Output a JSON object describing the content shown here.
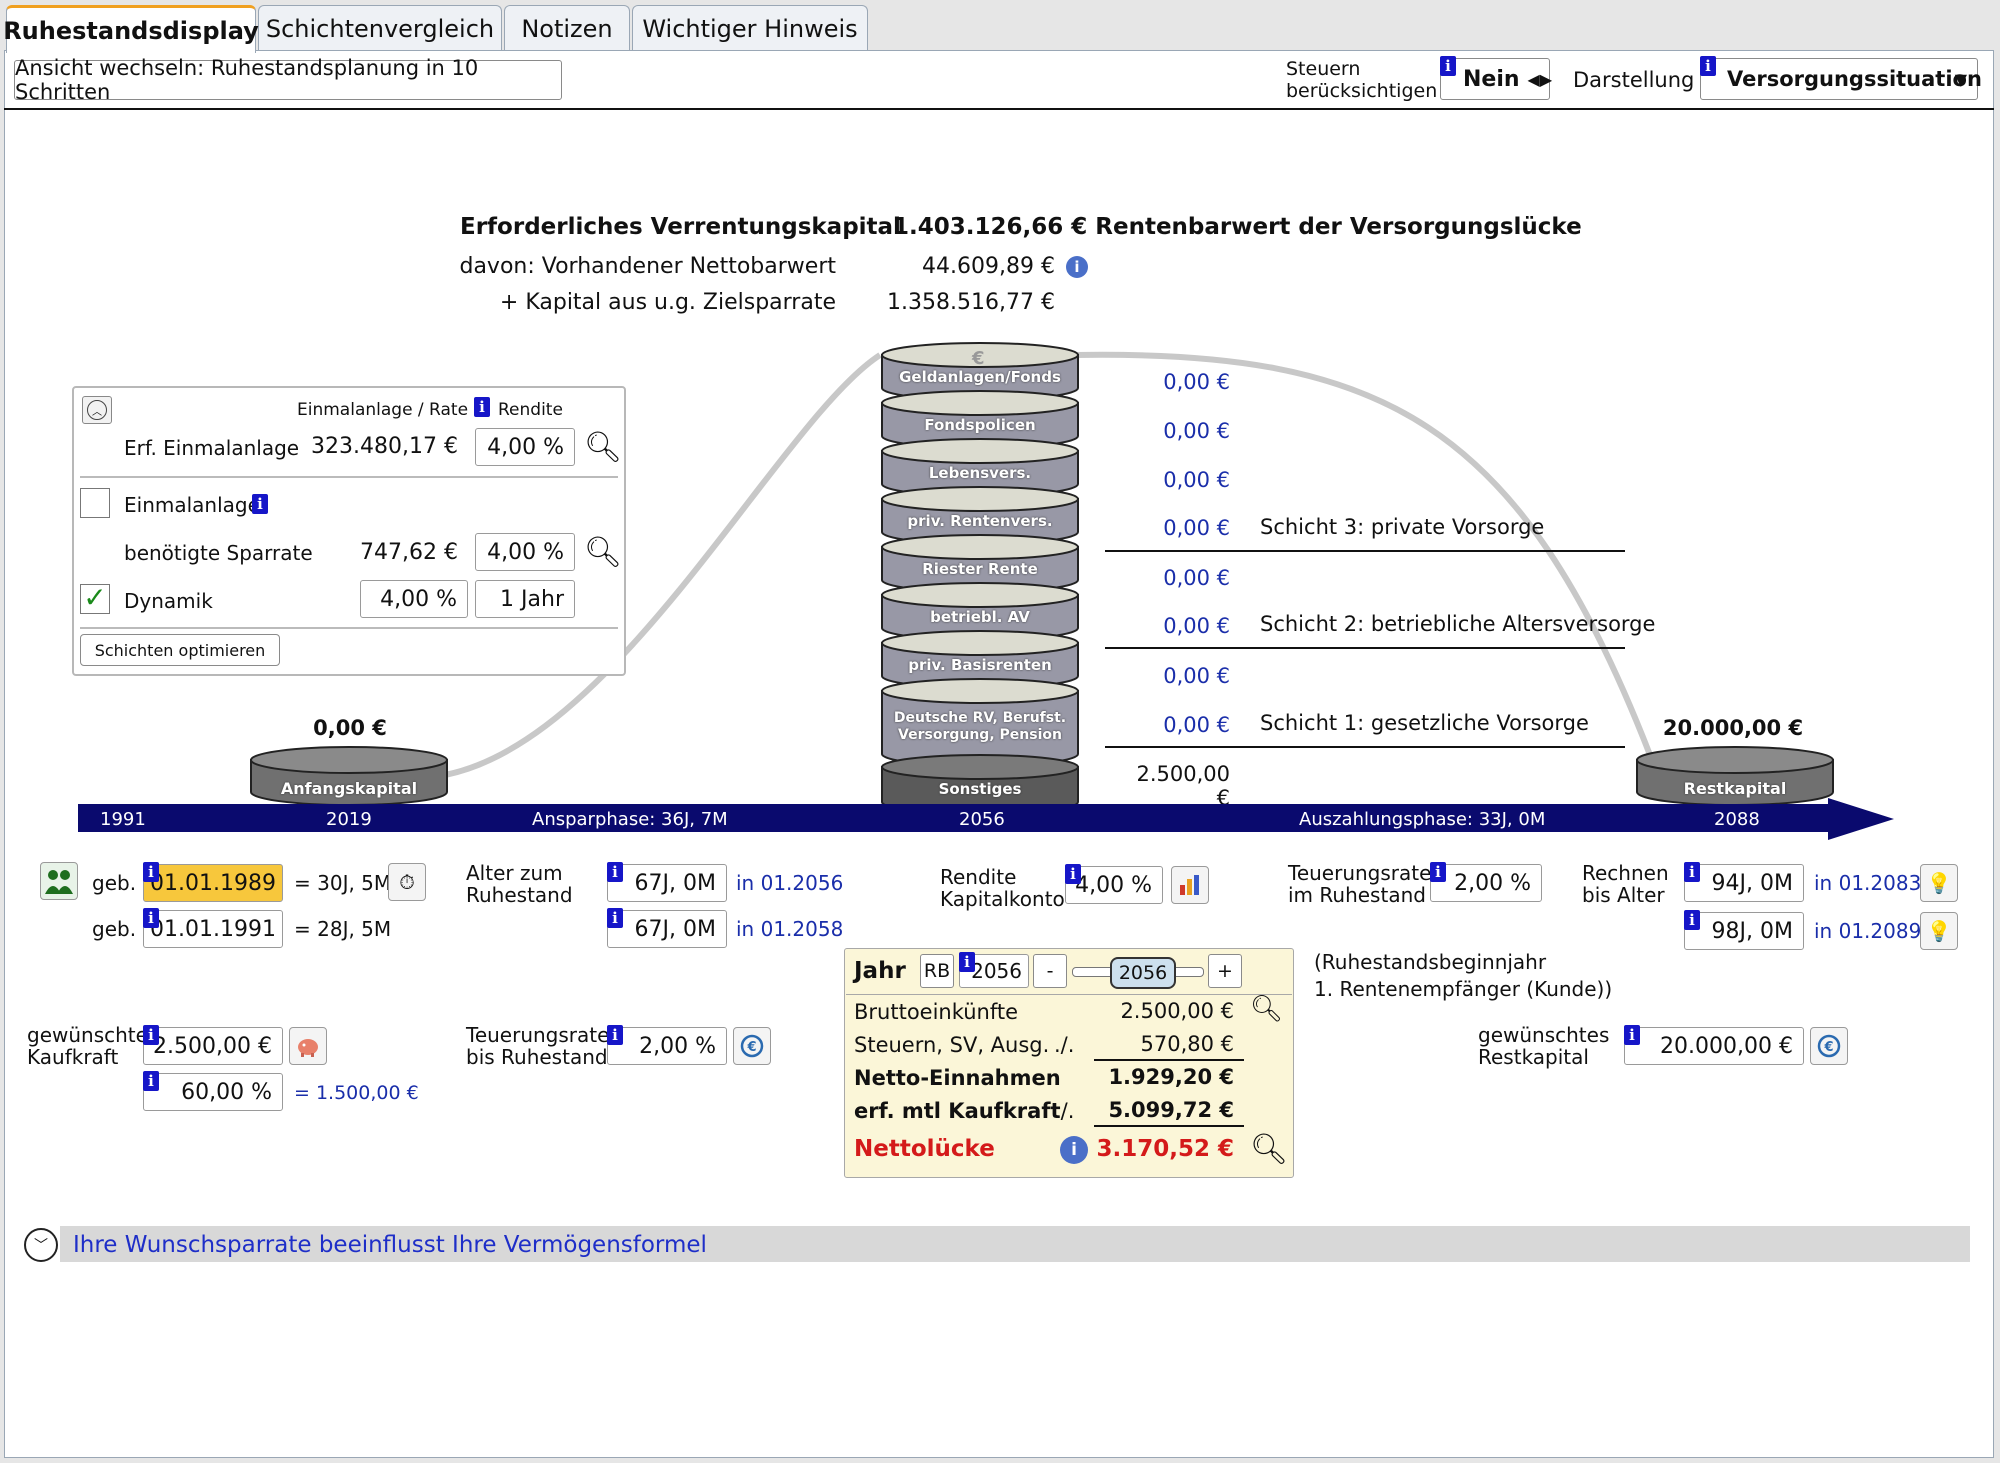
{
  "tabs": [
    {
      "label": "Ruhestandsdisplay",
      "active": true
    },
    {
      "label": "Schichtenvergleich",
      "active": false
    },
    {
      "label": "Notizen",
      "active": false
    },
    {
      "label": "Wichtiger Hinweis",
      "active": false
    }
  ],
  "toolbar": {
    "view_switch_label": "Ansicht wechseln: Ruhestandsplanung in 10 Schritten",
    "taxes_label_1": "Steuern",
    "taxes_label_2": "berücksichtigen",
    "taxes_value": "Nein",
    "display_label": "Darstellung",
    "display_value": "Versorgungssituation"
  },
  "summary": {
    "required_label": "Erforderliches Verrentungskapital",
    "required_value": "1.403.126,66 € Rentenbarwert der Versorgungslücke",
    "existing_label": "davon: Vorhandener Nettobarwert",
    "existing_value": "44.609,89 €",
    "savings_label": "+ Kapital aus u.g. Zielsparrate",
    "savings_value": "1.358.516,77 €"
  },
  "calc_panel": {
    "header_col1": "Einmalanlage / Rate",
    "header_col2": "Rendite",
    "erf_label": "Erf. Einmalanlage",
    "erf_value": "323.480,17 €",
    "erf_rate": "4,00 %",
    "einmal_label": "Einmalanlage",
    "einmal_checked": false,
    "spar_label": "benötigte Sparrate",
    "spar_value": "747,62 €",
    "spar_rate": "4,00 %",
    "dyn_label": "Dynamik",
    "dyn_checked": true,
    "dyn_rate": "4,00 %",
    "dyn_period": "1 Jahr",
    "optimize_label": "Schichten optimieren"
  },
  "start": {
    "value": "0,00 €",
    "label": "Anfangskapital"
  },
  "end": {
    "value": "20.000,00 €",
    "label": "Restkapital"
  },
  "layers": [
    {
      "label": "Geldanlagen/Fonds",
      "value": "0,00 €",
      "euro_symbol": "€"
    },
    {
      "label": "Fondspolicen",
      "value": "0,00 €"
    },
    {
      "label": "Lebensvers.",
      "value": "0,00 €"
    },
    {
      "label": "priv. Rentenvers.",
      "value": "0,00 €"
    },
    {
      "label": "Riester Rente",
      "value": "0,00 €"
    },
    {
      "label": "betriebl. AV",
      "value": "0,00 €"
    },
    {
      "label": "priv. Basisrenten",
      "value": "0,00 €"
    },
    {
      "label": "Deutsche RV, Berufst. Versorgung, Pension",
      "value": "0,00 €"
    },
    {
      "label": "Sonstiges",
      "value": "2.500,00 €"
    }
  ],
  "layer_groups": {
    "s3": "Schicht 3: private Vorsorge",
    "s2": "Schicht 2: betriebliche Altersversorge",
    "s1": "Schicht 1: gesetzliche Vorsorge"
  },
  "timeline": {
    "y1": "1991",
    "y2": "2019",
    "phase1": "Ansparphase: 36J, 7M",
    "y3": "2056",
    "phase2": "Auszahlungsphase: 33J, 0M",
    "y4": "2088",
    "color": "#0a0a6e"
  },
  "persons": {
    "geb_label": "geb.",
    "p1_date": "01.01.1989",
    "p1_age": "= 30J, 5M",
    "p2_date": "01.01.1991",
    "p2_age": "= 28J, 5M"
  },
  "retirement_age": {
    "label_1": "Alter zum",
    "label_2": "Ruhestand",
    "p1_value": "67J, 0M",
    "p1_in": "in 01.2056",
    "p2_value": "67J, 0M",
    "p2_in": "in 01.2058"
  },
  "rendite_konto": {
    "label_1": "Rendite",
    "label_2": "Kapitalkonto",
    "value": "4,00 %"
  },
  "teuerung_ruhestand": {
    "label_1": "Teuerungsrate",
    "label_2": "im Ruhestand",
    "value": "2,00 %"
  },
  "rechnen_alter": {
    "label_1": "Rechnen",
    "label_2": "bis Alter",
    "p1_value": "94J, 0M",
    "p1_in": "in 01.2083",
    "p2_value": "98J, 0M",
    "p2_in": "in 01.2089"
  },
  "kaufkraft": {
    "label_1": "gewünschte",
    "label_2": "Kaufkraft",
    "value": "2.500,00 €",
    "percent": "60,00 %",
    "result": "= 1.500,00 €"
  },
  "teuerung_bis": {
    "label_1": "Teuerungsrate",
    "label_2": "bis Ruhestand",
    "value": "2,00 %"
  },
  "year_box": {
    "jahr_label": "Jahr",
    "rb_label": "RB",
    "year_input": "2056",
    "minus": "-",
    "slider_value": "2056",
    "plus": "+",
    "brutto_label": "Bruttoeinkünfte",
    "brutto_value": "2.500,00 €",
    "steuern_label": "Steuern, SV, Ausg.",
    "steuern_op": "./.",
    "steuern_value": "570,80 €",
    "netto_label": "Netto-Einnahmen",
    "netto_value": "1.929,20 €",
    "kaufkraft_label": "erf. mtl Kaufkraft",
    "kaufkraft_op": "./.",
    "kaufkraft_value": "5.099,72 €",
    "luecke_label": "Nettolücke",
    "luecke_value": "3.170,52 €"
  },
  "rb_note": {
    "line1": "(Ruhestandsbeginnjahr",
    "line2": "1. Rentenempfänger (Kunde))"
  },
  "restkapital_input": {
    "label_1": "gewünschtes",
    "label_2": "Restkapital",
    "value": "20.000,00 €"
  },
  "footer": {
    "expander_label": "Ihre Wunschsparrate beeinflusst Ihre Vermögensformel"
  },
  "info_badge": "i"
}
